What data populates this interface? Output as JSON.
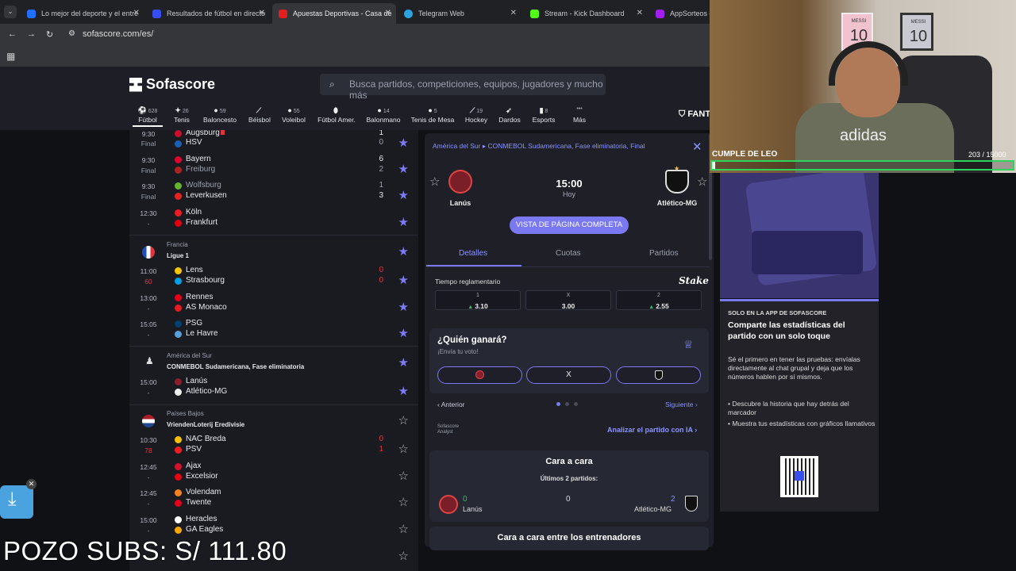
{
  "browser": {
    "tabs": [
      {
        "label": "Lo mejor del deporte y el entre",
        "fav_color": "#1f6fff"
      },
      {
        "label": "Resultados de fútbol en directo",
        "fav_color": "#374df5"
      },
      {
        "label": "Apuestas Deportivas - Casa de",
        "fav_color": "#e02020"
      },
      {
        "label": "Telegram Web",
        "fav_color": "#2aa3e0"
      },
      {
        "label": "Stream - Kick Dashboard",
        "fav_color": "#53fc18"
      },
      {
        "label": "AppSorteos – L",
        "fav_color": "#a020f0"
      }
    ],
    "close_glyph": "✕",
    "url": "sofascore.com/es/"
  },
  "header": {
    "logo": "Sofascore",
    "search_placeholder": "Busca partidos, competiciones, equipos, jugadores y mucho más",
    "sports": [
      {
        "name": "Fútbol",
        "count": "628"
      },
      {
        "name": "Tenis",
        "count": "26"
      },
      {
        "name": "Baloncesto",
        "count": "59"
      },
      {
        "name": "Béisbol",
        "count": ""
      },
      {
        "name": "Voleibol",
        "count": "55"
      },
      {
        "name": "Fútbol Amer.",
        "count": ""
      },
      {
        "name": "Balonmano",
        "count": "14"
      },
      {
        "name": "Tenis de Mesa",
        "count": "5"
      },
      {
        "name": "Hockey",
        "count": "19"
      },
      {
        "name": "Dardos",
        "count": ""
      },
      {
        "name": "Esports",
        "count": "8"
      },
      {
        "name": "Más",
        "count": ""
      }
    ],
    "fantasy": "FANT"
  },
  "matches": {
    "bundesliga": [
      {
        "time": "9:30",
        "status": "Final",
        "home": "Augsburg",
        "away": "HSV",
        "hs": "1",
        "as": "0"
      },
      {
        "time": "9:30",
        "status": "Final",
        "home": "Bayern",
        "away": "Freiburg",
        "hs": "6",
        "as": "2"
      },
      {
        "time": "9:30",
        "status": "Final",
        "home": "Wolfsburg",
        "away": "Leverkusen",
        "hs": "1",
        "as": "3"
      },
      {
        "time": "12:30",
        "status": "-",
        "home": "Köln",
        "away": "Frankfurt",
        "hs": "",
        "as": ""
      }
    ],
    "ligue1": {
      "country": "Francia",
      "name": "Ligue 1",
      "rows": [
        {
          "time": "11:00",
          "status": "60",
          "home": "Lens",
          "away": "Strasbourg",
          "hs": "0",
          "as": "0"
        },
        {
          "time": "13:00",
          "status": "-",
          "home": "Rennes",
          "away": "AS Monaco",
          "hs": "",
          "as": ""
        },
        {
          "time": "15:05",
          "status": "-",
          "home": "PSG",
          "away": "Le Havre",
          "hs": "",
          "as": ""
        }
      ]
    },
    "conmebol": {
      "country": "América del Sur",
      "name": "CONMEBOL Sudamericana, Fase eliminatoria",
      "rows": [
        {
          "time": "15:00",
          "status": "-",
          "home": "Lanús",
          "away": "Atlético-MG",
          "hs": "",
          "as": ""
        }
      ]
    },
    "eredivisie": {
      "country": "Países Bajos",
      "name": "VriendenLoterij Eredivisie",
      "rows": [
        {
          "time": "10:30",
          "status": "78",
          "home": "NAC Breda",
          "away": "PSV",
          "hs": "0",
          "as": "1"
        },
        {
          "time": "12:45",
          "status": "-",
          "home": "Ajax",
          "away": "Excelsior",
          "hs": "",
          "as": ""
        },
        {
          "time": "12:45",
          "status": "-",
          "home": "Volendam",
          "away": "Twente",
          "hs": "",
          "as": ""
        },
        {
          "time": "15:00",
          "status": "-",
          "home": "Heracles",
          "away": "GA Eagles",
          "hs": "",
          "as": ""
        }
      ]
    }
  },
  "panel": {
    "breadcrumb": "América del Sur ▸ CONMEBOL Sudamericana, Fase eliminatoria, Final",
    "home": "Lanús",
    "away": "Atlético-MG",
    "kickoff": "15:00",
    "day": "Hoy",
    "full_page": "VISTA DE PÁGINA COMPLETA",
    "tabs": [
      "Detalles",
      "Cuotas",
      "Partidos"
    ],
    "odds_title": "Tiempo reglamentario",
    "bookmaker": "Stake",
    "odds": [
      {
        "label": "1",
        "value": "3.10"
      },
      {
        "label": "X",
        "value": "3.00"
      },
      {
        "label": "2",
        "value": "2.55"
      }
    ],
    "who_title": "¿Quién ganará?",
    "who_sub": "¡Envía tu voto!",
    "vote_draw": "X",
    "prev": "Anterior",
    "next": "Siguiente",
    "analyst_logo": "Sofascore Analyst",
    "analyze": "Analizar el partido con IA",
    "h2h_title": "Cara a cara",
    "h2h_sub": "Últimos 2 partidos:",
    "h2h_home_wins": "0",
    "h2h_draws": "0",
    "h2h_away_wins": "2",
    "coach": "Cara a cara entre los entrenadores"
  },
  "ad": {
    "kicker": "SOLO EN LA APP DE SOFASCORE",
    "title": "Comparte las estadísticas del partido con un solo toque",
    "body": "Sé el primero en tener las pruebas: envíalas directamente al chat grupal y deja que los números hablen por sí mismos.",
    "bullets": [
      "Descubre la historia que hay detrás del marcador",
      "Muestra tus estadísticas con gráficos llamativos"
    ]
  },
  "stream": {
    "title": "CUMPLE DE LEO",
    "count": "203 / 15000",
    "pozo": "POZO SUBS: S/ 111.80",
    "shirt_text": "adidas",
    "poster_1_name": "MESSI",
    "poster_1_number": "10",
    "poster_2_name": "MESSI",
    "poster_2_number": "10"
  }
}
